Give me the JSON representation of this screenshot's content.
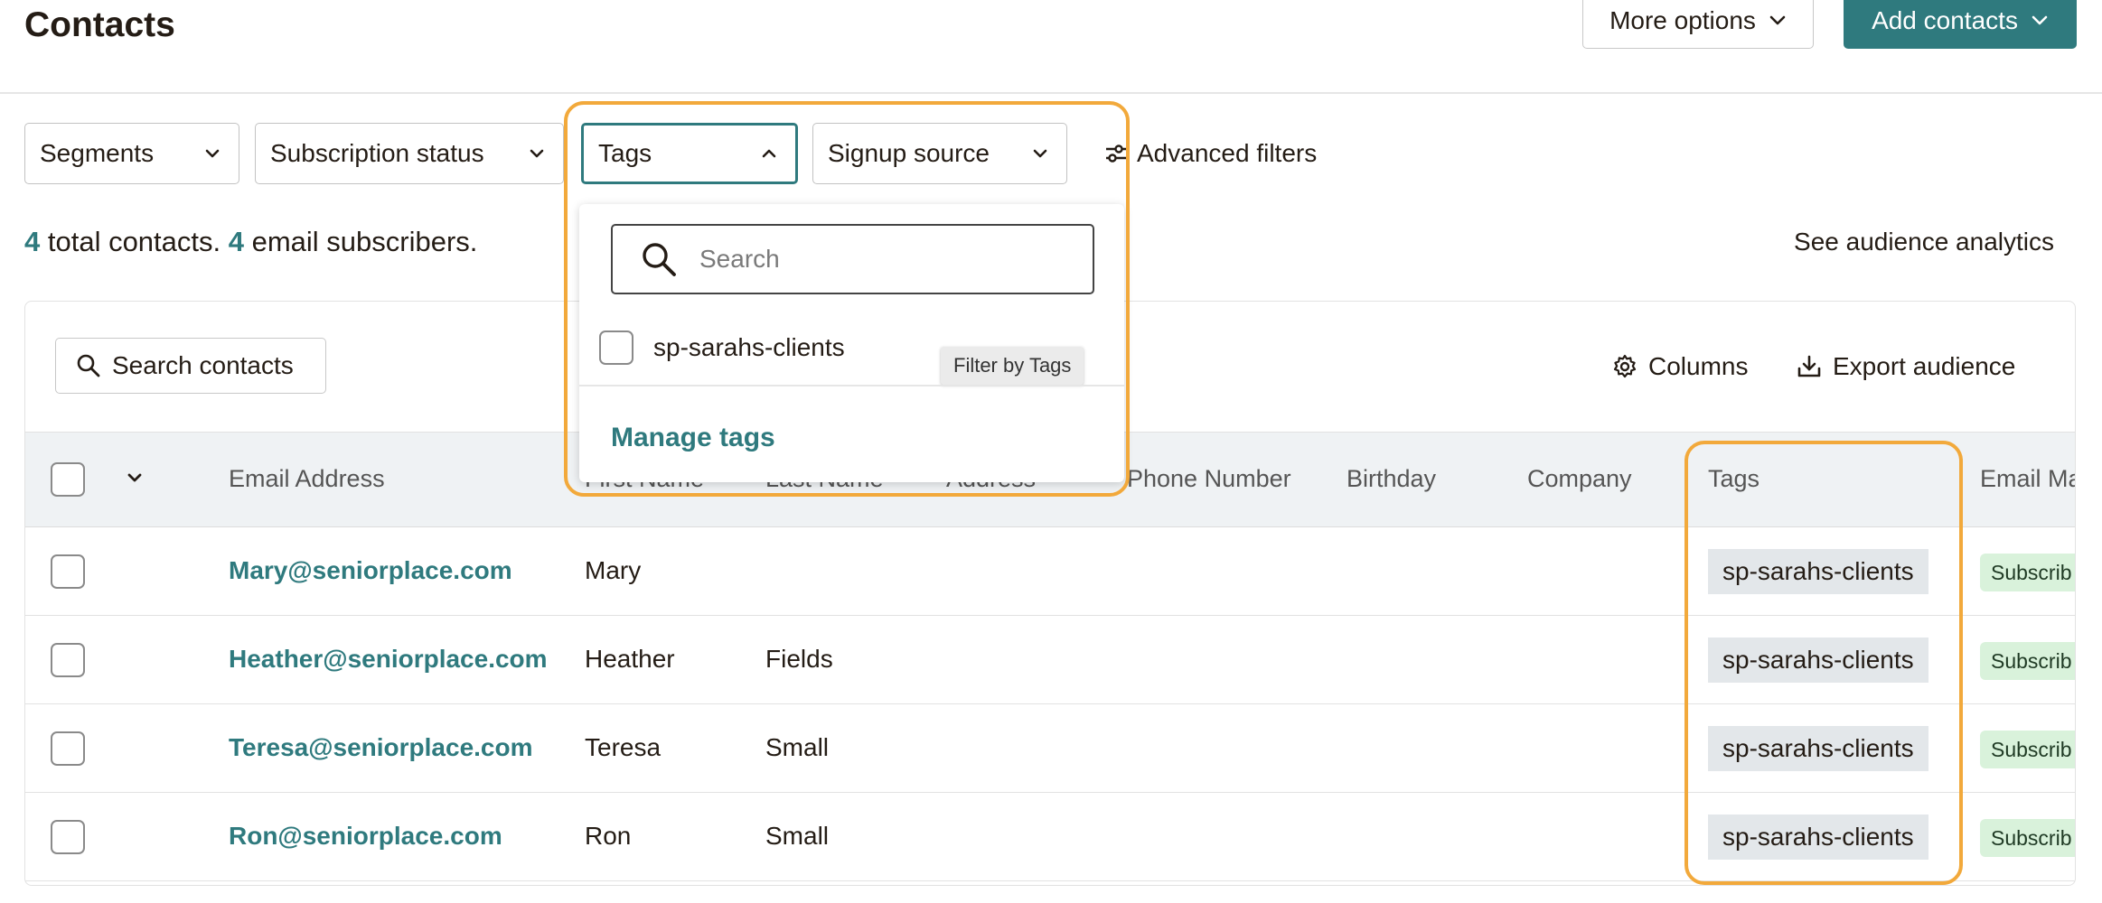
{
  "header": {
    "title": "Contacts",
    "more_options_label": "More options",
    "add_contacts_label": "Add contacts"
  },
  "filters": {
    "segments_label": "Segments",
    "subscription_status_label": "Subscription status",
    "tags_label": "Tags",
    "signup_source_label": "Signup source",
    "advanced_filters_label": "Advanced filters"
  },
  "summary": {
    "total_count": "4",
    "total_text": " total contacts. ",
    "subscriber_count": "4",
    "subscriber_text": " email subscribers.",
    "analytics_link": "See audience analytics"
  },
  "tags_dropdown": {
    "search_placeholder": "Search",
    "option_label": "sp-sarahs-clients",
    "tooltip": "Filter by Tags",
    "manage_label": "Manage tags"
  },
  "toolbar": {
    "search_contacts_label": "Search contacts",
    "columns_label": "Columns",
    "export_label": "Export audience"
  },
  "table": {
    "columns": {
      "email": "Email Address",
      "first_name": "First Name",
      "last_name": "Last Name",
      "address": "Address",
      "phone": "Phone Number",
      "birthday": "Birthday",
      "company": "Company",
      "tags": "Tags",
      "email_marketing": "Email Ma"
    },
    "rows": [
      {
        "email": "Mary@seniorplace.com",
        "first_name": "Mary",
        "last_name": "",
        "tag": "sp-sarahs-clients",
        "status": "Subscrib"
      },
      {
        "email": "Heather@seniorplace.com",
        "first_name": "Heather",
        "last_name": "Fields",
        "tag": "sp-sarahs-clients",
        "status": "Subscrib"
      },
      {
        "email": "Teresa@seniorplace.com",
        "first_name": "Teresa",
        "last_name": "Small",
        "tag": "sp-sarahs-clients",
        "status": "Subscrib"
      },
      {
        "email": "Ron@seniorplace.com",
        "first_name": "Ron",
        "last_name": "Small",
        "tag": "sp-sarahs-clients",
        "status": "Subscrib"
      }
    ]
  },
  "colors": {
    "accent": "#2f7a7e",
    "highlight": "#f2a93b",
    "subscribed_bg": "#d9f2db",
    "tag_bg": "#e3e7ea"
  },
  "icons": [
    "chevron-down-icon",
    "chevron-up-icon",
    "sliders-icon",
    "search-icon",
    "gear-icon",
    "download-icon"
  ]
}
